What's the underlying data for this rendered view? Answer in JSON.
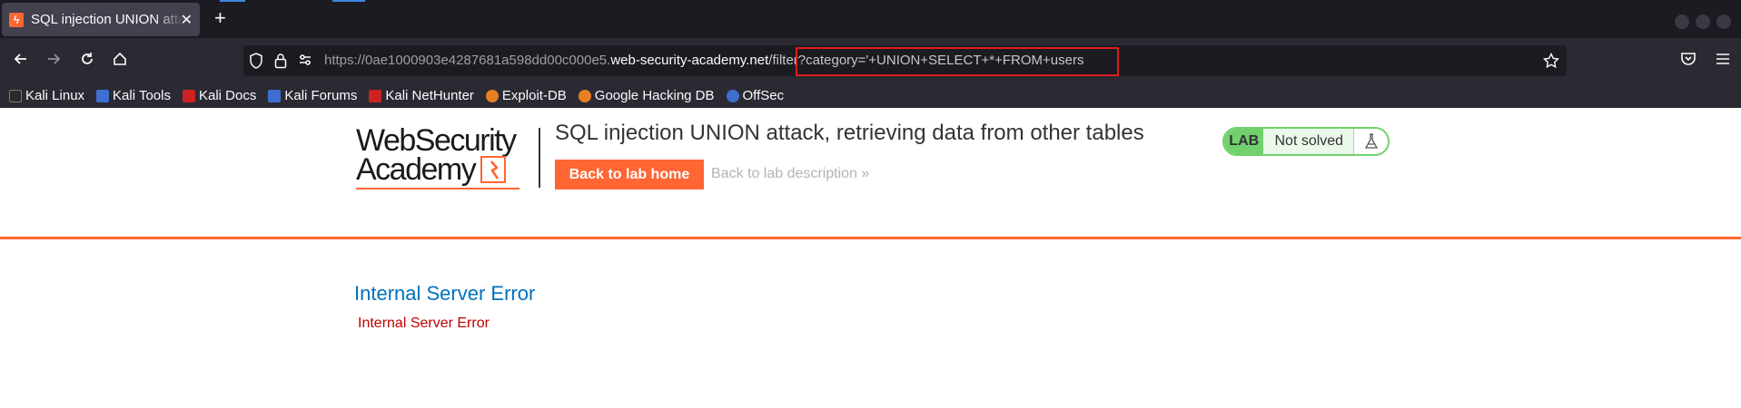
{
  "browser": {
    "tab": {
      "title": "SQL injection UNION attack, retrieving data from other tables",
      "close": "✕"
    },
    "new_tab": "+",
    "url": {
      "prefix": "https://0ae1000903e4287681a598dd00c000e5.",
      "host": "web-security-academy.net",
      "path": "/filter?category='+UNION+SELECT+*+FROM+users"
    },
    "bookmarks": [
      {
        "label": "Kali Linux",
        "color": "#2a2a2a"
      },
      {
        "label": "Kali Tools",
        "color": "#3d6fd1"
      },
      {
        "label": "Kali Docs",
        "color": "#cc2222"
      },
      {
        "label": "Kali Forums",
        "color": "#3d6fd1"
      },
      {
        "label": "Kali NetHunter",
        "color": "#cc2222"
      },
      {
        "label": "Exploit-DB",
        "color": "#e67e22"
      },
      {
        "label": "Google Hacking DB",
        "color": "#e67e22"
      },
      {
        "label": "OffSec",
        "color": "#3d6fd1"
      }
    ]
  },
  "page": {
    "logo": {
      "line1": "WebSecurity",
      "line2": "Academy"
    },
    "lab_title": "SQL injection UNION attack, retrieving data from other tables",
    "back_home": "Back to lab home",
    "back_description": "Back to lab description »",
    "lab_badge": {
      "tag": "LAB",
      "status": "Not solved"
    },
    "error_heading": "Internal Server Error",
    "error_text": "Internal Server Error"
  },
  "colors": {
    "accent": "#ff6633",
    "highlight_box": "#e01b1b",
    "lab_green": "#70d16d",
    "error_heading": "#0071bc",
    "error_text": "#c00000"
  }
}
